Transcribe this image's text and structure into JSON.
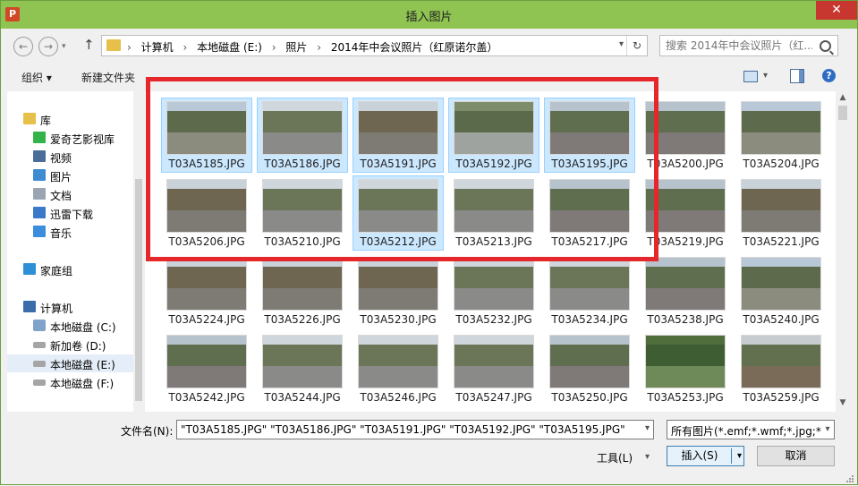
{
  "window": {
    "title": "插入图片",
    "app_icon_letter": "P",
    "close_glyph": "✕"
  },
  "nav": {
    "back_glyph": "←",
    "forward_glyph": "→",
    "up_glyph": "↑",
    "breadcrumb": [
      "计算机",
      "本地磁盘 (E:)",
      "照片",
      "2014年中会议照片（红原诺尔盖）"
    ],
    "breadcrumb_sep": "›",
    "refresh_glyph": "↻",
    "search_placeholder": "搜索 2014年中会议照片（红..."
  },
  "toolbar": {
    "organize": "组织 ▾",
    "new_folder": "新建文件夹",
    "view_dd": "▾",
    "help": "?"
  },
  "sidebar": {
    "items": [
      {
        "label": "库",
        "icon": "library-icon",
        "indent": 0
      },
      {
        "label": "爱奇艺影视库",
        "icon": "iqiyi-icon",
        "indent": 1
      },
      {
        "label": "视频",
        "icon": "video-icon",
        "indent": 1
      },
      {
        "label": "图片",
        "icon": "pictures-icon",
        "indent": 1
      },
      {
        "label": "文档",
        "icon": "documents-icon",
        "indent": 1
      },
      {
        "label": "迅雷下载",
        "icon": "download-icon",
        "indent": 1
      },
      {
        "label": "音乐",
        "icon": "music-icon",
        "indent": 1
      },
      {
        "label": "家庭组",
        "icon": "homegroup-icon",
        "indent": 0
      },
      {
        "label": "计算机",
        "icon": "computer-icon",
        "indent": 0
      },
      {
        "label": "本地磁盘 (C:)",
        "icon": "drive-c-icon",
        "indent": 1
      },
      {
        "label": "新加卷 (D:)",
        "icon": "drive-icon",
        "indent": 1
      },
      {
        "label": "本地磁盘 (E:)",
        "icon": "drive-icon",
        "indent": 1,
        "selected": true
      },
      {
        "label": "本地磁盘 (F:)",
        "icon": "drive-icon",
        "indent": 1
      }
    ]
  },
  "files": [
    {
      "name": "T03A5185.JPG",
      "selected": true,
      "scene": "mountain"
    },
    {
      "name": "T03A5186.JPG",
      "selected": true,
      "scene": "road"
    },
    {
      "name": "T03A5191.JPG",
      "selected": true,
      "scene": "gate"
    },
    {
      "name": "T03A5192.JPG",
      "selected": true,
      "scene": "river"
    },
    {
      "name": "T03A5195.JPG",
      "selected": true,
      "scene": "people"
    },
    {
      "name": "T03A5200.JPG",
      "selected": false,
      "scene": "people"
    },
    {
      "name": "T03A5204.JPG",
      "selected": false,
      "scene": "mountain"
    },
    {
      "name": "T03A5206.JPG",
      "selected": false,
      "scene": "gate"
    },
    {
      "name": "T03A5210.JPG",
      "selected": false,
      "scene": "road"
    },
    {
      "name": "T03A5212.JPG",
      "selected": true,
      "scene": "road"
    },
    {
      "name": "T03A5213.JPG",
      "selected": false,
      "scene": "road"
    },
    {
      "name": "T03A5217.JPG",
      "selected": false,
      "scene": "people"
    },
    {
      "name": "T03A5219.JPG",
      "selected": false,
      "scene": "people"
    },
    {
      "name": "T03A5221.JPG",
      "selected": false,
      "scene": "gate"
    },
    {
      "name": "T03A5224.JPG",
      "selected": false,
      "scene": "gate"
    },
    {
      "name": "T03A5226.JPG",
      "selected": false,
      "scene": "gate"
    },
    {
      "name": "T03A5230.JPG",
      "selected": false,
      "scene": "gate"
    },
    {
      "name": "T03A5232.JPG",
      "selected": false,
      "scene": "road"
    },
    {
      "name": "T03A5234.JPG",
      "selected": false,
      "scene": "road"
    },
    {
      "name": "T03A5238.JPG",
      "selected": false,
      "scene": "people"
    },
    {
      "name": "T03A5240.JPG",
      "selected": false,
      "scene": "mountain"
    },
    {
      "name": "T03A5242.JPG",
      "selected": false,
      "scene": "people"
    },
    {
      "name": "T03A5244.JPG",
      "selected": false,
      "scene": "road"
    },
    {
      "name": "T03A5246.JPG",
      "selected": false,
      "scene": "road"
    },
    {
      "name": "T03A5247.JPG",
      "selected": false,
      "scene": "road"
    },
    {
      "name": "T03A5250.JPG",
      "selected": false,
      "scene": "people"
    },
    {
      "name": "T03A5253.JPG",
      "selected": false,
      "scene": "forest"
    },
    {
      "name": "T03A5259.JPG",
      "selected": false,
      "scene": "bridge"
    }
  ],
  "footer": {
    "filename_label": "文件名(N):",
    "filename_value": "\"T03A5185.JPG\" \"T03A5186.JPG\" \"T03A5191.JPG\" \"T03A5192.JPG\" \"T03A5195.JPG\"",
    "filetype_value": "所有图片(*.emf;*.wmf;*.jpg;*.jp",
    "tools_label": "工具(L)",
    "insert_label": "插入(S)",
    "cancel_label": "取消",
    "dropdown_glyph": "▾"
  },
  "colors": {
    "titlebar": "#8fc453",
    "close": "#c7372f",
    "selection_fill": "#cce8ff",
    "selection_border": "#99d1ff",
    "annotation_box": "#e5262b"
  }
}
